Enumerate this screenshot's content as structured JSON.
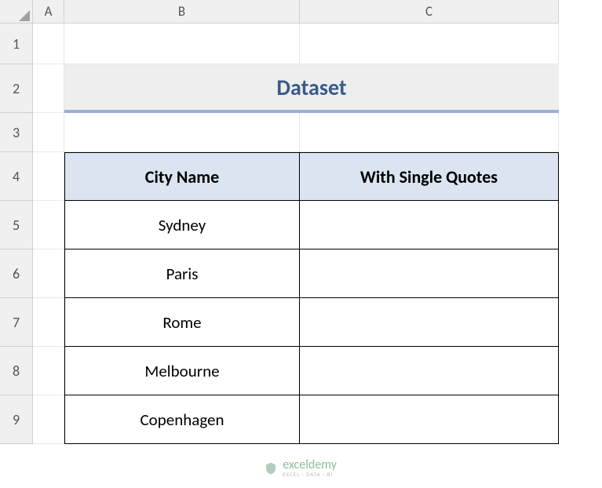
{
  "columns": [
    "A",
    "B",
    "C"
  ],
  "rows": [
    "1",
    "2",
    "3",
    "4",
    "5",
    "6",
    "7",
    "8",
    "9"
  ],
  "title": "Dataset",
  "headers": {
    "colB": "City Name",
    "colC": "With Single Quotes"
  },
  "data": {
    "r5": {
      "b": "Sydney",
      "c": ""
    },
    "r6": {
      "b": "Paris",
      "c": ""
    },
    "r7": {
      "b": "Rome",
      "c": ""
    },
    "r8": {
      "b": "Melbourne",
      "c": ""
    },
    "r9": {
      "b": "Copenhagen",
      "c": ""
    }
  },
  "watermark": {
    "main": "exceldemy",
    "sub": "EXCEL · DATA · BI"
  }
}
